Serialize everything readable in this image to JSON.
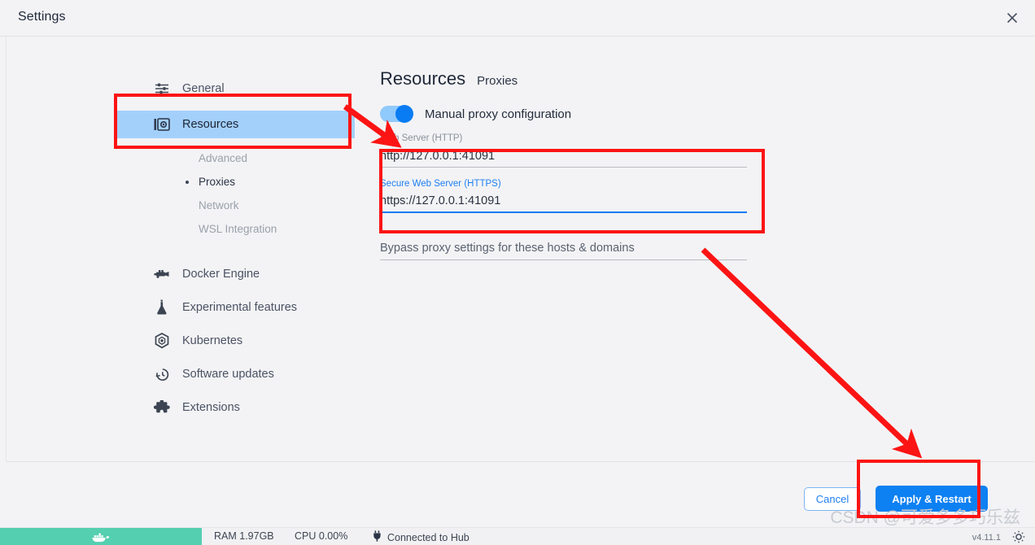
{
  "window": {
    "title": "Settings",
    "close_icon": "close-icon"
  },
  "sidebar": {
    "items": [
      {
        "label": "General",
        "icon": "sliders-icon",
        "selected": false
      },
      {
        "label": "Resources",
        "icon": "resources-icon",
        "selected": true
      }
    ],
    "sub_items": [
      {
        "label": "Advanced",
        "active": false
      },
      {
        "label": "Proxies",
        "active": true
      },
      {
        "label": "Network",
        "active": false
      },
      {
        "label": "WSL Integration",
        "active": false
      }
    ],
    "lower_items": [
      {
        "label": "Docker Engine",
        "icon": "engine-icon"
      },
      {
        "label": "Experimental features",
        "icon": "flask-icon"
      },
      {
        "label": "Kubernetes",
        "icon": "kubernetes-icon"
      },
      {
        "label": "Software updates",
        "icon": "clock-history-icon"
      },
      {
        "label": "Extensions",
        "icon": "puzzle-icon"
      }
    ]
  },
  "main": {
    "title": "Resources",
    "subtitle": "Proxies",
    "toggle": {
      "label": "Manual proxy configuration",
      "on": true
    },
    "fields": [
      {
        "label": "Web Server (HTTP)",
        "value": "http://127.0.0.1:41091",
        "focused": false
      },
      {
        "label": "Secure Web Server (HTTPS)",
        "value": "https://127.0.0.1:41091",
        "focused": true
      }
    ],
    "bypass": {
      "placeholder": "Bypass proxy settings for these hosts & domains",
      "value": ""
    }
  },
  "footer": {
    "cancel_label": "Cancel",
    "apply_label": "Apply & Restart"
  },
  "statusbar": {
    "ram": "RAM 1.97GB",
    "cpu": "CPU 0.00%",
    "hub": "Connected to Hub",
    "hub_icon": "plug-icon",
    "version": "v4.11.1",
    "gear_icon": "gear-icon",
    "whale_icon": "docker-whale-icon"
  },
  "watermark": {
    "text": "CSDN @可爱多多巧乐兹"
  },
  "annotations": {
    "accent_color": "#fc1414",
    "boxes": [
      {
        "name": "resources-highlight"
      },
      {
        "name": "proxy-fields-highlight"
      },
      {
        "name": "apply-restart-highlight"
      }
    ],
    "arrows": [
      {
        "name": "arrow-to-web-server-label"
      },
      {
        "name": "arrow-to-apply-restart"
      }
    ]
  },
  "colors": {
    "accent_blue": "#0a7cf3",
    "selection_blue": "#a3d0fb",
    "status_green": "#54cfb0",
    "annotation_red": "#fc1414"
  }
}
